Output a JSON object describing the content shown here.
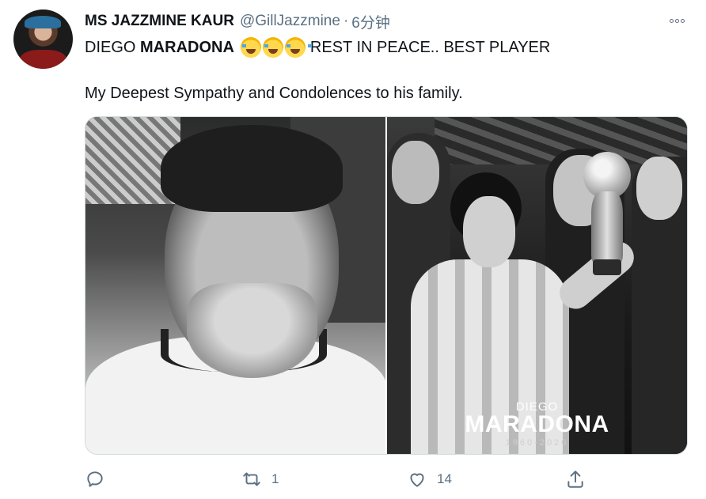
{
  "tweet": {
    "author_name": "MS JAZZMINE KAUR",
    "author_handle": "@GillJazzmine",
    "separator": "·",
    "timestamp": "6分钟",
    "text_line1_prefix": "DIEGO ",
    "text_line1_bold": "MARADONA",
    "text_line1_suffix": "REST IN PEACE.. BEST PLAYER",
    "text_line2": "My Deepest Sympathy and Condolences to his family."
  },
  "media": {
    "caption_first": "DIEGO",
    "caption_last": "MARADONA",
    "caption_years": "1960-2020"
  },
  "actions": {
    "reply_count": "",
    "retweet_count": "1",
    "like_count": "14",
    "icons": [
      "reply-icon",
      "retweet-icon",
      "like-icon",
      "share-icon",
      "more-icon"
    ]
  },
  "colors": {
    "muted": "#5b7083",
    "text": "#0f1419",
    "border": "#cfd9de"
  }
}
